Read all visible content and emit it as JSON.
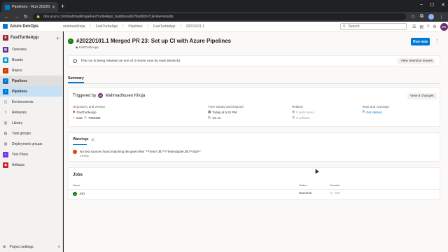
{
  "browser": {
    "tab_title": "Pipelines - Run 20220101.1",
    "url": "dev.azure.com/mahmadkhoja/FastTurtleApp/_build/results?buildId=21&view=results"
  },
  "header": {
    "brand": "Azure DevOps",
    "breadcrumbs": [
      "mahmadkhoja",
      "FastTurtleApp",
      "Pipelines",
      "FastTurtleApp",
      "20220101.1"
    ],
    "search_placeholder": "Search",
    "avatar_initials": "MK"
  },
  "sidebar": {
    "project": "FastTurtleApp",
    "project_initial": "F",
    "items": [
      {
        "label": "Overview",
        "color": "#5c2d91"
      },
      {
        "label": "Boards",
        "color": "#009ccc"
      },
      {
        "label": "Repos",
        "color": "#d83b01"
      },
      {
        "label": "Pipelines",
        "color": "#0078d4"
      },
      {
        "label": "Pipelines",
        "color": "#0078d4"
      },
      {
        "label": "Environments",
        "color": "#605e5c"
      },
      {
        "label": "Releases",
        "color": "#605e5c"
      },
      {
        "label": "Library",
        "color": "#605e5c"
      },
      {
        "label": "Task groups",
        "color": "#605e5c"
      },
      {
        "label": "Deployment groups",
        "color": "#605e5c"
      },
      {
        "label": "Test Plans",
        "color": "#773adc"
      },
      {
        "label": "Artifacts",
        "color": "#cc2229"
      }
    ],
    "footer": "Project settings"
  },
  "run": {
    "title": "#20220101.1 Merged PR 23: Set up CI with Azure Pipelines",
    "repo": "FastTurtleApp",
    "run_button": "Run new"
  },
  "banner": {
    "text": "This run is being retained as one of 3 recent runs by main (Branch).",
    "button": "View retention leases"
  },
  "tabs": {
    "summary": "Summary"
  },
  "summary": {
    "triggered_by_label": "Triggered by",
    "triggered_by_name": "Mahmadhusen Khoja",
    "view_changes": "View 6 changes",
    "col_repo_header": "Repository and version",
    "repo_name": "FastTurtleApp",
    "branch": "main",
    "commit": "7086398",
    "col_time_header": "Time started and elapsed",
    "time_started": "Today at 5:41 PM",
    "elapsed": "1m 1s",
    "col_related_header": "Related",
    "work_items": "0 work items",
    "artifacts": "0 artifacts",
    "col_tests_header": "Tests and coverage",
    "get_started": "Get started"
  },
  "warnings": {
    "header": "Warnings",
    "count": "1",
    "message": "No test sources found matching the given filter '**\\*test*.dll,!**\\*TestAdapter.dll,!**\\obj\\**'",
    "source": "VSTest"
  },
  "jobs": {
    "header": "Jobs",
    "col_name": "Name",
    "col_status": "Status",
    "col_duration": "Duration",
    "rows": [
      {
        "name": "Job",
        "status": "Success",
        "duration": "53s"
      }
    ]
  }
}
